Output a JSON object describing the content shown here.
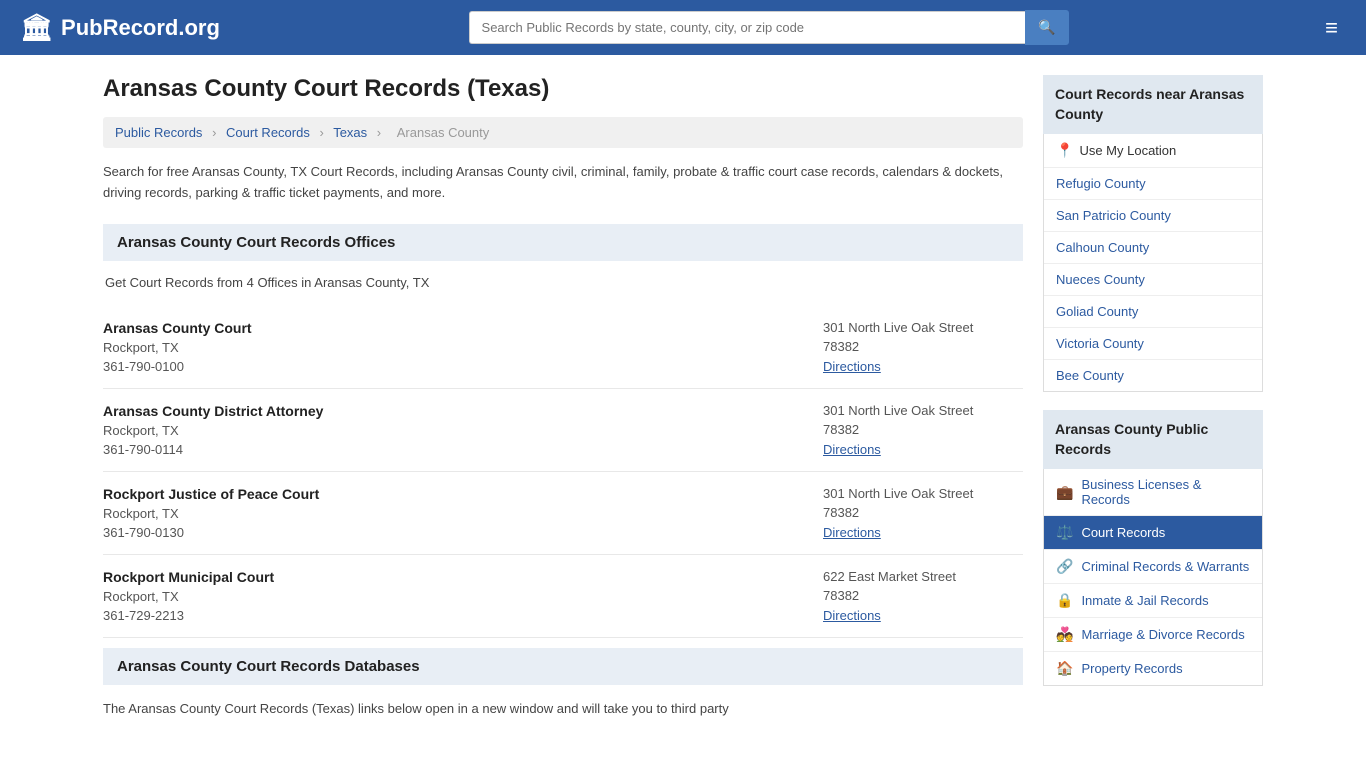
{
  "header": {
    "logo_text": "PubRecord.org",
    "search_placeholder": "Search Public Records by state, county, city, or zip code",
    "search_icon": "🔍",
    "menu_icon": "≡"
  },
  "page": {
    "title": "Aransas County Court Records (Texas)",
    "breadcrumb": {
      "items": [
        "Public Records",
        "Court Records",
        "Texas",
        "Aransas County"
      ]
    },
    "description": "Search for free Aransas County, TX Court Records, including Aransas County civil, criminal, family, probate & traffic court case records, calendars & dockets, driving records, parking & traffic ticket payments, and more.",
    "offices_section_header": "Aransas County Court Records Offices",
    "offices_intro": "Get Court Records from 4 Offices in Aransas County, TX",
    "offices": [
      {
        "name": "Aransas County Court",
        "city": "Rockport, TX",
        "phone": "361-790-0100",
        "address": "301 North Live Oak Street",
        "zip": "78382",
        "directions": "Directions"
      },
      {
        "name": "Aransas County District Attorney",
        "city": "Rockport, TX",
        "phone": "361-790-0114",
        "address": "301 North Live Oak Street",
        "zip": "78382",
        "directions": "Directions"
      },
      {
        "name": "Rockport Justice of Peace Court",
        "city": "Rockport, TX",
        "phone": "361-790-0130",
        "address": "301 North Live Oak Street",
        "zip": "78382",
        "directions": "Directions"
      },
      {
        "name": "Rockport Municipal Court",
        "city": "Rockport, TX",
        "phone": "361-729-2213",
        "address": "622 East Market Street",
        "zip": "78382",
        "directions": "Directions"
      }
    ],
    "databases_section_header": "Aransas County Court Records Databases",
    "databases_description": "The Aransas County Court Records (Texas) links below open in a new window and will take you to third party"
  },
  "sidebar": {
    "nearby_header": "Court Records near Aransas County",
    "nearby_items": [
      {
        "label": "Use My Location",
        "type": "location"
      },
      {
        "label": "Refugio County"
      },
      {
        "label": "San Patricio County"
      },
      {
        "label": "Calhoun County"
      },
      {
        "label": "Nueces County"
      },
      {
        "label": "Goliad County"
      },
      {
        "label": "Victoria County"
      },
      {
        "label": "Bee County"
      }
    ],
    "public_records_header": "Aransas County Public Records",
    "public_records_items": [
      {
        "label": "Business Licenses & Records",
        "icon": "💼",
        "active": false
      },
      {
        "label": "Court Records",
        "icon": "⚖️",
        "active": true
      },
      {
        "label": "Criminal Records & Warrants",
        "icon": "🔗",
        "active": false
      },
      {
        "label": "Inmate & Jail Records",
        "icon": "🔒",
        "active": false
      },
      {
        "label": "Marriage & Divorce Records",
        "icon": "💑",
        "active": false
      },
      {
        "label": "Property Records",
        "icon": "🏠",
        "active": false
      }
    ]
  }
}
